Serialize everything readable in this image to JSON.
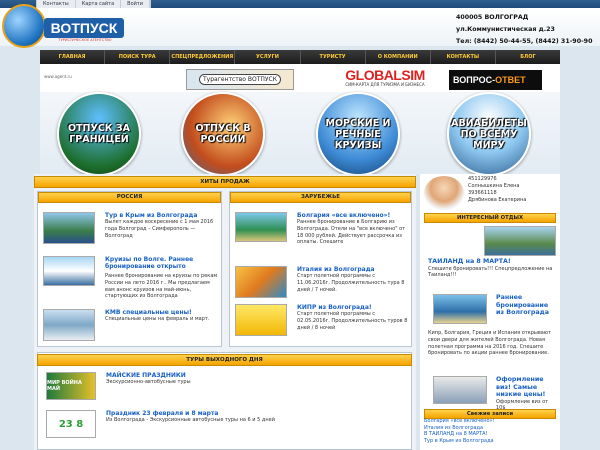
{
  "top_links": [
    "Контакты",
    "Карта сайта",
    "Войти"
  ],
  "logo": {
    "text": "ВОТПУСК",
    "subtitle": "ТУРИСТИЧЕСКОЕ АГЕНТСТВО"
  },
  "contact": {
    "line1": "400005 ВОЛГОГРАД",
    "line2": "ул.Коммунистическая д.23",
    "line3": "Тел: (8442) 50-44-55, (8442) 31-90-90"
  },
  "nav": [
    "ГЛАВНАЯ",
    "ПОИСК ТУРА",
    "СПЕЦПРЕДЛОЖЕНИЯ",
    "УСЛУГИ",
    "ТУРИСТУ",
    "О КОМПАНИИ",
    "КОНТАКТЫ",
    "БЛОГ"
  ],
  "banners": {
    "small_text": "www.agent.ru",
    "agency": "Турагентство ВОТПУСК",
    "global_title": "GLOBALSIM",
    "global_sub": "СИМ-КАРТА ДЛЯ ТУРИЗМА И БИЗНЕСА",
    "qa_1": "ВОПРОС-",
    "qa_2": "ОТВЕТ"
  },
  "circles": [
    "ОТПУСК ЗА ГРАНИЦЕЙ",
    "ОТПУСК В РОССИИ",
    "МОРСКИЕ И РЕЧНЫЕ КРУИЗЫ",
    "АВИАБИЛЕТЫ ПО ВСЕМУ МИРУ"
  ],
  "hits_title": "ХИТЫ ПРОДАЖ",
  "russia": {
    "title": "РОССИЯ",
    "items": [
      {
        "title": "Тур в Крым из Волгограда",
        "text": "Вылет каждое воскресение с 1 мая 2016 года Волгоград – Симферополь — Волгоград"
      },
      {
        "title": "Круизы по Волге. Раннее бронирование открыто",
        "text": "Раннее бронирование на круизы по рекам России на лето 2016 г.. Мы предлагаем вам анонс круизов на май-июнь, стартующих из Волгограда"
      },
      {
        "title": "КМВ специальные цены!",
        "text": "Специальные цены на февраль и март."
      }
    ]
  },
  "abroad": {
    "title": "ЗАРУБЕЖЬЕ",
    "items": [
      {
        "title": "Болгария «все включено»!",
        "text": "Раннее бронирование в Болгарию из Волгограда. Отели на \"все включено\" от 18 000 рублей. Действует рассрочка из оплаты. Спешите"
      },
      {
        "title": "Италия из Волгограда",
        "text": "Старт полетной программы с 11.06.2016г. Продолжительность тура 8 дней / 7 ночей."
      },
      {
        "title": "КИПР из Волгограда!",
        "text": "Старт полетной программы с 02.05.2016г. Продолжительность туров 8 дней / 8 ночей"
      }
    ]
  },
  "weekend": {
    "title": "ТУРЫ ВЫХОДНОГО ДНЯ",
    "items": [
      {
        "title": "МАЙСКИЕ ПРАЗДНИКИ",
        "text": "Экскурсионно-автобусные туры",
        "thumb": "МИР ВОЙНА МАЙ"
      },
      {
        "title": "Праздник 23 февраля и 8 марта",
        "text": "Из Волгограда - Экскурсионные автобусные туры на 6 и 5 дней",
        "thumb": "23 8"
      }
    ]
  },
  "manager": {
    "phone": "451129976",
    "name1": "Солнышкина Елена",
    "phone2": "393661118",
    "name2": "Дрябинова Екатерина"
  },
  "interesting": {
    "title": "ИНТЕРЕСНЫЙ ОТДЫХ",
    "items": [
      {
        "title": "ТАИЛАНД на 8 МАРТА!",
        "text": "Спешите бронировать!!! Спецпредложение на Таиланд!!!"
      },
      {
        "title": "Раннее бронирование из Волгограда",
        "text": "Кипр, Болгария, Греция и Испания открывают свои двери для жителей Волгограда. Новая полетная программа на 2016 год. Спешите бронировать по акции раннее бронирование."
      },
      {
        "title": "Оформление виз! Самые низкие цены!",
        "text": "Оформление виз от 10$"
      }
    ]
  },
  "news": {
    "title": "Свежие записи",
    "items": [
      "Болгария «все включено»!",
      "Италия из Волгограда",
      "В ТАИЛАНД на 8 МАРТА!",
      "Тур в Крым из Волгограда"
    ]
  }
}
